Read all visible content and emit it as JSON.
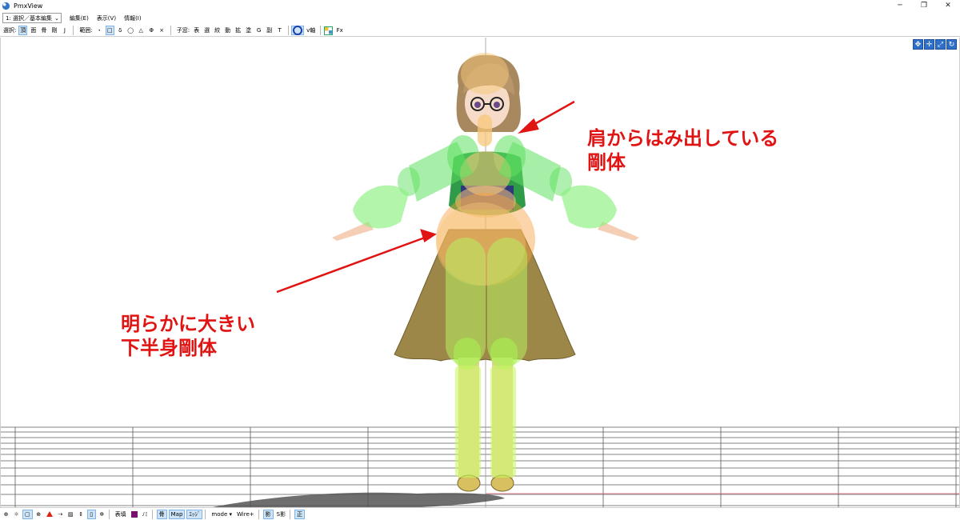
{
  "window": {
    "title": "PmxView"
  },
  "menubar": {
    "mode_select": "1: 選択／基本編集",
    "items": [
      "編集(E)",
      "表示(V)",
      "情報(I)"
    ]
  },
  "toolbar": {
    "select_label": "選択:",
    "select_buttons": [
      "頂",
      "面",
      "骨",
      "剛",
      "J"
    ],
    "range_label": "範囲:",
    "range_buttons": [
      "・",
      "□",
      "δ",
      "◯",
      "△",
      "Φ",
      "×"
    ],
    "view_label": "子窓:",
    "view_buttons": [
      "表",
      "選",
      "絞",
      "動",
      "拡",
      "塗",
      "G",
      "副",
      "T"
    ],
    "vaxis_label": "v軸",
    "fx_label": "Fx"
  },
  "annotations": {
    "shoulder_line1": "肩からはみ出している",
    "shoulder_line2": "剛体",
    "lower_line1": "明らかに大きい",
    "lower_line2": "下半身剛体"
  },
  "statusbar": {
    "expression_label": "表填",
    "slash_label": "ﾉﾐ",
    "bone_label": "骨",
    "map_label": "Map",
    "edge_label": "ｴｯｼﾞ",
    "mode_label": "mode",
    "wire_label": "Wire+",
    "shadow_label": "影",
    "sshadow_label": "S影",
    "front_label": "正"
  },
  "colors": {
    "annotation": "#e11414",
    "rigid_green": "#5fe060",
    "rigid_orange": "#f7c77a",
    "selected_btn": "#cde4f7"
  }
}
